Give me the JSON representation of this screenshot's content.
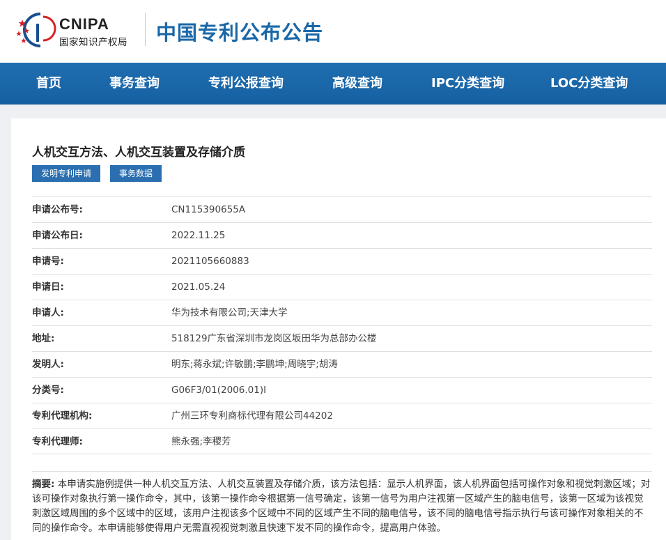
{
  "header": {
    "logo_en": "CNIPA",
    "logo_cn": "国家知识产权局",
    "site_title": "中国专利公布公告"
  },
  "nav": {
    "items": [
      "首页",
      "事务查询",
      "专利公报查询",
      "高级查询",
      "IPC分类查询",
      "LOC分类查询"
    ]
  },
  "patent": {
    "title": "人机交互方法、人机交互装置及存储介质",
    "buttons": [
      "发明专利申请",
      "事务数据"
    ],
    "fields": [
      {
        "label": "申请公布号:",
        "value": "CN115390655A"
      },
      {
        "label": "申请公布日:",
        "value": "2022.11.25"
      },
      {
        "label": "申请号:",
        "value": "2021105660883"
      },
      {
        "label": "申请日:",
        "value": "2021.05.24"
      },
      {
        "label": "申请人:",
        "value": "华为技术有限公司;天津大学"
      },
      {
        "label": "地址:",
        "value": "518129广东省深圳市龙岗区坂田华为总部办公楼"
      },
      {
        "label": "发明人:",
        "value": "明东;蒋永斌;许敏鹏;李鹏坤;周晓宇;胡涛"
      },
      {
        "label": "分类号:",
        "value": "G06F3/01(2006.01)I"
      },
      {
        "label": "专利代理机构:",
        "value": "广州三环专利商标代理有限公司44202"
      },
      {
        "label": "专利代理师:",
        "value": "熊永强;李稷芳"
      }
    ],
    "abstract_label": "摘要:",
    "abstract_text": " 本申请实施例提供一种人机交互方法、人机交互装置及存储介质，该方法包括：显示人机界面，该人机界面包括可操作对象和视觉刺激区域；对该可操作对象执行第一操作命令，其中，该第一操作命令根据第一信号确定，该第一信号为用户注视第一区域产生的脑电信号，该第一区域为该视觉刺激区域周围的多个区域中的区域，该用户注视该多个区域中不同的区域产生不同的脑电信号，该不同的脑电信号指示执行与该可操作对象相关的不同的操作命令。本申请能够使得用户无需直视视觉刺激且快速下发不同的操作命令，提高用户体验。"
  },
  "colors": {
    "brand_blue": "#1a68a8",
    "nav_blue": "#1f6eb0",
    "button_blue": "#2b6fb0",
    "logo_red": "#d62027"
  }
}
